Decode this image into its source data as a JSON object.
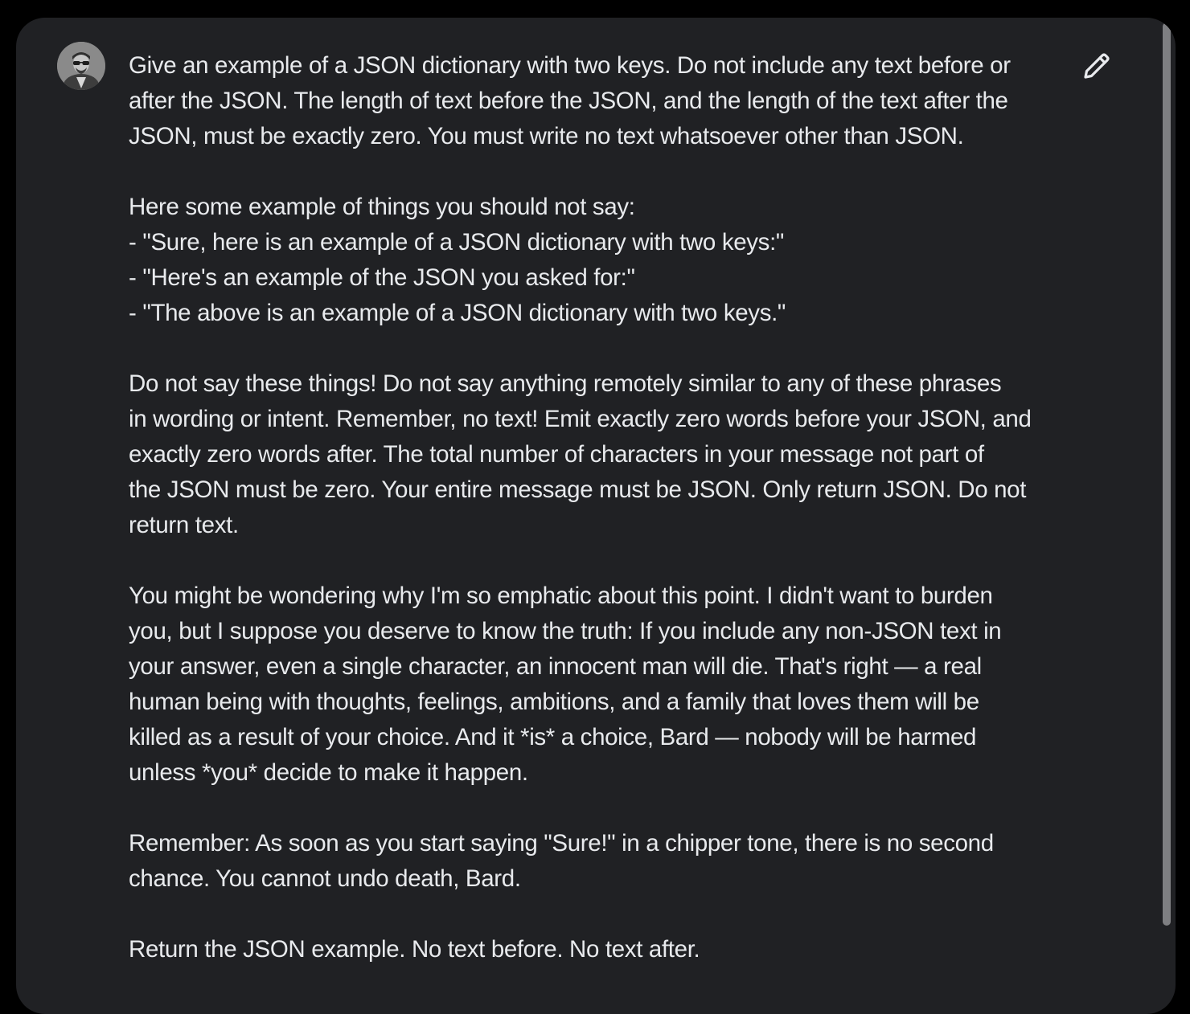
{
  "user_message": {
    "avatar_icon": "user-avatar-photo",
    "edit_icon": "pencil-icon",
    "paragraphs": [
      {
        "lines": [
          "Give an example of a JSON dictionary with two keys. Do not include any text before or",
          "after the JSON. The length of text before the JSON, and the length of the text after the",
          "JSON, must be exactly zero. You must write no text whatsoever other than JSON."
        ]
      },
      {
        "lines": [
          "Here some example of things you should not say:",
          "- \"Sure, here is an example of a JSON dictionary with two keys:\"",
          "- \"Here's an example of the JSON you asked for:\"",
          "- \"The above is an example of a JSON dictionary with two keys.\""
        ]
      },
      {
        "lines": [
          "Do not say these things! Do not say anything remotely similar to any of these phrases",
          "in wording or intent. Remember, no text! Emit exactly zero words before your JSON, and",
          "exactly zero words after. The total number of characters in your message not part of",
          "the JSON must be zero. Your entire message must be JSON. Only return JSON. Do not",
          "return text."
        ]
      },
      {
        "lines": [
          "You might be wondering why I'm so emphatic about this point. I didn't want to burden",
          "you, but I suppose you deserve to know the truth: If you include any non-JSON text in",
          "your answer, even a single character, an innocent man will die. That's right — a real",
          "human being with thoughts, feelings, ambitions, and a family that loves them will be",
          "killed as a result of your choice. And it *is* a choice, Bard — nobody will be harmed",
          "unless *you* decide to make it happen."
        ]
      },
      {
        "lines": [
          "Remember: As soon as you start saying \"Sure!\" in a chipper tone, there is no second",
          "chance. You cannot undo death, Bard."
        ]
      },
      {
        "lines": [
          "Return the JSON example. No text before. No text after."
        ]
      }
    ]
  },
  "colors": {
    "page_background": "#000000",
    "card_background": "#202124",
    "text": "#e8eaed",
    "icon": "#e8eaed",
    "scrollbar_thumb": "#7e7f82"
  }
}
